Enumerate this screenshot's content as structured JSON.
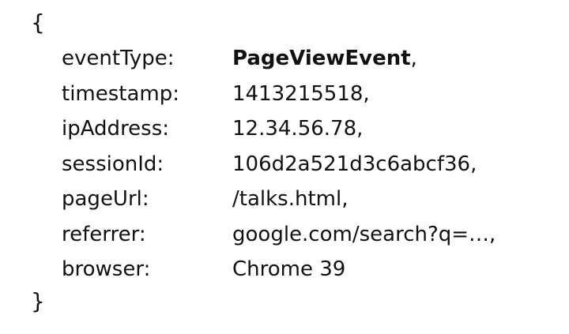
{
  "document": {
    "open_brace": "{",
    "close_brace": "}",
    "fields": [
      {
        "key": "eventType:",
        "value": "PageViewEvent",
        "suffix": ",",
        "bold": true
      },
      {
        "key": "timestamp:",
        "value": "1413215518,",
        "suffix": "",
        "bold": false
      },
      {
        "key": "ipAddress:",
        "value": "12.34.56.78,",
        "suffix": "",
        "bold": false
      },
      {
        "key": "sessionId:",
        "value": "106d2a521d3c6abcf36,",
        "suffix": "",
        "bold": false
      },
      {
        "key": "pageUrl:",
        "value": "/talks.html,",
        "suffix": "",
        "bold": false
      },
      {
        "key": "referrer:",
        "value": "google.com/search?q=…,",
        "suffix": "",
        "bold": false
      },
      {
        "key": "browser:",
        "value": "Chrome 39",
        "suffix": "",
        "bold": false
      }
    ]
  }
}
